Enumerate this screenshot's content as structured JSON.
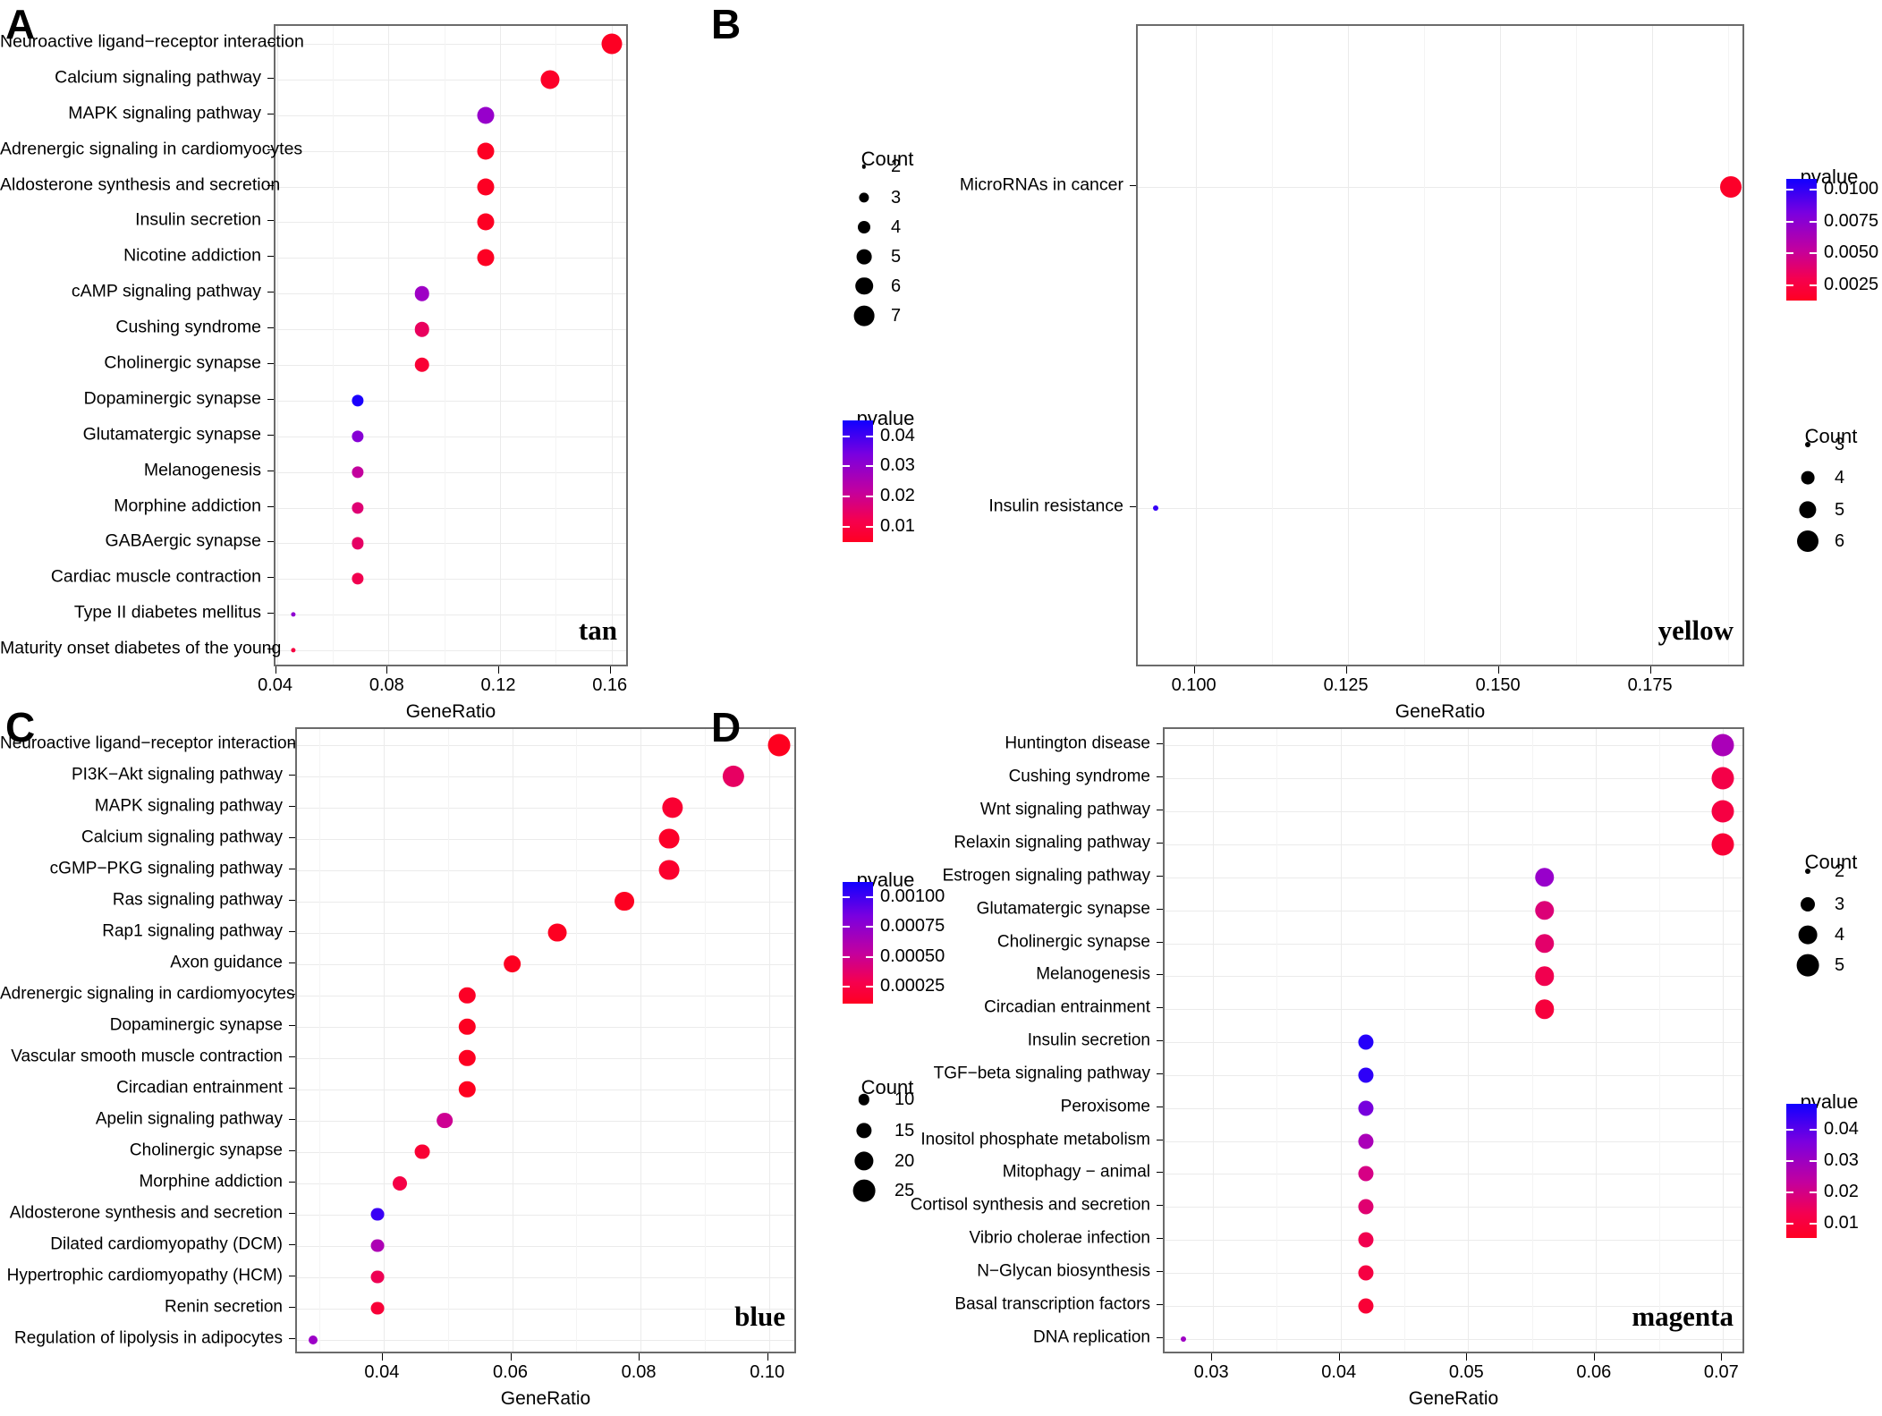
{
  "figure": {
    "axis_title": "GeneRatio",
    "legend_titles": {
      "count": "Count",
      "pvalue": "pvalue"
    }
  },
  "panels": [
    {
      "letter": "A",
      "module_tag": "tan",
      "chart_data": {
        "type": "scatter",
        "title": "",
        "xlabel": "GeneRatio",
        "ylabel": "",
        "xlim": [
          0.0395,
          0.1665
        ],
        "xticks": [
          "0.04",
          "0.08",
          "0.12",
          "0.16"
        ],
        "xtickvals": [
          0.04,
          0.08,
          0.12,
          0.16
        ],
        "grid": true,
        "legend_position": "right",
        "size_legend": {
          "title": "Count",
          "values": [
            2,
            3,
            4,
            5,
            6,
            7
          ]
        },
        "color_legend": {
          "title": "pvalue",
          "ticks": [
            "0.04",
            "0.03",
            "0.02",
            "0.01"
          ],
          "tickvals": [
            0.04,
            0.03,
            0.02,
            0.01
          ],
          "vmin": 0.0045,
          "vmax": 0.045
        },
        "categories": [
          "Neuroactive ligand-receptor interaction",
          "Calcium signaling pathway",
          "MAPK signaling pathway",
          "Adrenergic signaling in cardiomyocytes",
          "Aldosterone synthesis and secretion",
          "Insulin secretion",
          "Nicotine addiction",
          "cAMP signaling pathway",
          "Cushing syndrome",
          "Cholinergic synapse",
          "Dopaminergic synapse",
          "Glutamatergic synapse",
          "Melanogenesis",
          "Morphine addiction",
          "GABAergic synapse",
          "Cardiac muscle contraction",
          "Type II diabetes mellitus",
          "Maturity onset diabetes of the young"
        ],
        "points": [
          {
            "label": "Neuroactive ligand-receptor interaction",
            "x": 0.16,
            "count": 7,
            "pvalue": 0.006
          },
          {
            "label": "Calcium signaling pathway",
            "x": 0.138,
            "count": 6,
            "pvalue": 0.007
          },
          {
            "label": "MAPK signaling pathway",
            "x": 0.115,
            "count": 5,
            "pvalue": 0.031
          },
          {
            "label": "Adrenergic signaling in cardiomyocytes",
            "x": 0.115,
            "count": 5,
            "pvalue": 0.006
          },
          {
            "label": "Aldosterone synthesis and secretion",
            "x": 0.115,
            "count": 5,
            "pvalue": 0.006
          },
          {
            "label": "Insulin secretion",
            "x": 0.115,
            "count": 5,
            "pvalue": 0.006
          },
          {
            "label": "Nicotine addiction",
            "x": 0.115,
            "count": 5,
            "pvalue": 0.006
          },
          {
            "label": "cAMP signaling pathway",
            "x": 0.092,
            "count": 4,
            "pvalue": 0.03
          },
          {
            "label": "Cushing syndrome",
            "x": 0.092,
            "count": 4,
            "pvalue": 0.015
          },
          {
            "label": "Cholinergic synapse",
            "x": 0.092,
            "count": 4,
            "pvalue": 0.009
          },
          {
            "label": "Dopaminergic synapse",
            "x": 0.069,
            "count": 3,
            "pvalue": 0.044
          },
          {
            "label": "Glutamatergic synapse",
            "x": 0.069,
            "count": 3,
            "pvalue": 0.033
          },
          {
            "label": "Melanogenesis",
            "x": 0.069,
            "count": 3,
            "pvalue": 0.024
          },
          {
            "label": "Morphine addiction",
            "x": 0.069,
            "count": 3,
            "pvalue": 0.018
          },
          {
            "label": "GABAergic synapse",
            "x": 0.069,
            "count": 3,
            "pvalue": 0.016
          },
          {
            "label": "Cardiac muscle contraction",
            "x": 0.069,
            "count": 3,
            "pvalue": 0.013
          },
          {
            "label": "Type II diabetes mellitus",
            "x": 0.046,
            "count": 2,
            "pvalue": 0.032
          },
          {
            "label": "Maturity onset diabetes of the young",
            "x": 0.046,
            "count": 2,
            "pvalue": 0.011
          }
        ]
      }
    },
    {
      "letter": "B",
      "module_tag": "yellow",
      "chart_data": {
        "type": "scatter",
        "title": "",
        "xlabel": "GeneRatio",
        "ylabel": "",
        "xlim": [
          0.0905,
          0.1905
        ],
        "xticks": [
          "0.100",
          "0.125",
          "0.150",
          "0.175"
        ],
        "xtickvals": [
          0.1,
          0.125,
          0.15,
          0.175
        ],
        "grid": true,
        "legend_position": "right",
        "size_legend": {
          "title": "Count",
          "values": [
            3,
            4,
            5,
            6
          ]
        },
        "color_legend": {
          "title": "pvalue",
          "ticks": [
            "0.0100",
            "0.0075",
            "0.0050",
            "0.0025"
          ],
          "tickvals": [
            0.01,
            0.0075,
            0.005,
            0.0025
          ],
          "vmin": 0.0012,
          "vmax": 0.0108
        },
        "categories": [
          "MicroRNAs in cancer",
          "Insulin resistance"
        ],
        "points": [
          {
            "label": "MicroRNAs in cancer",
            "x": 0.188,
            "count": 6,
            "pvalue": 0.0018
          },
          {
            "label": "Insulin resistance",
            "x": 0.0935,
            "count": 3,
            "pvalue": 0.01
          }
        ]
      }
    },
    {
      "letter": "C",
      "module_tag": "blue",
      "chart_data": {
        "type": "scatter",
        "title": "",
        "xlabel": "GeneRatio",
        "ylabel": "",
        "xlim": [
          0.0265,
          0.1045
        ],
        "xticks": [
          "0.04",
          "0.06",
          "0.08",
          "0.10"
        ],
        "xtickvals": [
          0.04,
          0.06,
          0.08,
          0.1
        ],
        "grid": true,
        "legend_position": "right",
        "size_legend": {
          "title": "Count",
          "values": [
            10,
            15,
            20,
            25
          ]
        },
        "color_legend": {
          "title": "pvalue",
          "ticks": [
            "0.00100",
            "0.00075",
            "0.00050",
            "0.00025"
          ],
          "tickvals": [
            0.001,
            0.00075,
            0.0005,
            0.00025
          ],
          "vmin": 0.0001,
          "vmax": 0.00112
        },
        "categories": [
          "Neuroactive ligand-receptor interaction",
          "PI3K-Akt signaling pathway",
          "MAPK signaling pathway",
          "Calcium signaling pathway",
          "cGMP-PKG signaling pathway",
          "Ras signaling pathway",
          "Rap1 signaling pathway",
          "Axon guidance",
          "Adrenergic signaling in cardiomyocytes",
          "Dopaminergic synapse",
          "Vascular smooth muscle contraction",
          "Circadian entrainment",
          "Apelin signaling pathway",
          "Cholinergic synapse",
          "Morphine addiction",
          "Aldosterone synthesis and secretion",
          "Dilated cardiomyopathy (DCM)",
          "Hypertrophic cardiomyopathy (HCM)",
          "Renin secretion",
          "Regulation of lipolysis in adipocytes"
        ],
        "points": [
          {
            "label": "Neuroactive ligand-receptor interaction",
            "x": 0.1015,
            "count": 26,
            "pvalue": 0.00012
          },
          {
            "label": "PI3K-Akt signaling pathway",
            "x": 0.0945,
            "count": 24,
            "pvalue": 0.00038
          },
          {
            "label": "MAPK signaling pathway",
            "x": 0.085,
            "count": 22,
            "pvalue": 0.0002
          },
          {
            "label": "Calcium signaling pathway",
            "x": 0.0845,
            "count": 21,
            "pvalue": 0.00016
          },
          {
            "label": "cGMP-PKG signaling pathway",
            "x": 0.0845,
            "count": 21,
            "pvalue": 0.00018
          },
          {
            "label": "Ras signaling pathway",
            "x": 0.0775,
            "count": 19,
            "pvalue": 0.00013
          },
          {
            "label": "Rap1 signaling pathway",
            "x": 0.067,
            "count": 17,
            "pvalue": 0.00013
          },
          {
            "label": "Axon guidance",
            "x": 0.06,
            "count": 15,
            "pvalue": 0.00013
          },
          {
            "label": "Adrenergic signaling in cardiomyocytes",
            "x": 0.053,
            "count": 13,
            "pvalue": 0.00015
          },
          {
            "label": "Dopaminergic synapse",
            "x": 0.053,
            "count": 13,
            "pvalue": 0.00013
          },
          {
            "label": "Vascular smooth muscle contraction",
            "x": 0.053,
            "count": 13,
            "pvalue": 0.00013
          },
          {
            "label": "Circadian entrainment",
            "x": 0.053,
            "count": 13,
            "pvalue": 0.00012
          },
          {
            "label": "Apelin signaling pathway",
            "x": 0.0495,
            "count": 12,
            "pvalue": 0.00055
          },
          {
            "label": "Cholinergic synapse",
            "x": 0.046,
            "count": 11,
            "pvalue": 0.00021
          },
          {
            "label": "Morphine addiction",
            "x": 0.0425,
            "count": 10,
            "pvalue": 0.00028
          },
          {
            "label": "Aldosterone synthesis and secretion",
            "x": 0.039,
            "count": 9,
            "pvalue": 0.00102
          },
          {
            "label": "Dilated cardiomyopathy (DCM)",
            "x": 0.039,
            "count": 9,
            "pvalue": 0.00068
          },
          {
            "label": "Hypertrophic cardiomyopathy (HCM)",
            "x": 0.039,
            "count": 9,
            "pvalue": 0.00033
          },
          {
            "label": "Renin secretion",
            "x": 0.039,
            "count": 9,
            "pvalue": 0.00022
          },
          {
            "label": "Regulation of lipolysis in adipocytes",
            "x": 0.029,
            "count": 7,
            "pvalue": 0.00075
          }
        ]
      }
    },
    {
      "letter": "D",
      "module_tag": "magenta",
      "chart_data": {
        "type": "scatter",
        "title": "",
        "xlabel": "GeneRatio",
        "ylabel": "",
        "xlim": [
          0.0262,
          0.0718
        ],
        "xticks": [
          "0.03",
          "0.04",
          "0.05",
          "0.06",
          "0.07"
        ],
        "xtickvals": [
          0.03,
          0.04,
          0.05,
          0.06,
          0.07
        ],
        "grid": true,
        "legend_position": "right",
        "size_legend": {
          "title": "Count",
          "values": [
            2,
            3,
            4,
            5
          ]
        },
        "color_legend": {
          "title": "pvalue",
          "ticks": [
            "0.04",
            "0.03",
            "0.02",
            "0.01"
          ],
          "tickvals": [
            0.04,
            0.03,
            0.02,
            0.01
          ],
          "vmin": 0.005,
          "vmax": 0.048
        },
        "categories": [
          "Huntington disease",
          "Cushing syndrome",
          "Wnt signaling pathway",
          "Relaxin signaling pathway",
          "Estrogen signaling pathway",
          "Glutamatergic synapse",
          "Cholinergic synapse",
          "Melanogenesis",
          "Circadian entrainment",
          "Insulin secretion",
          "TGF-beta signaling pathway",
          "Peroxisome",
          "Inositol phosphate metabolism",
          "Mitophagy - animal",
          "Cortisol synthesis and secretion",
          "Vibrio cholerae infection",
          "N-Glycan biosynthesis",
          "Basal transcription factors",
          "DNA replication"
        ],
        "points": [
          {
            "label": "Huntington disease",
            "x": 0.07,
            "count": 5,
            "pvalue": 0.03
          },
          {
            "label": "Cushing syndrome",
            "x": 0.07,
            "count": 5,
            "pvalue": 0.013
          },
          {
            "label": "Wnt signaling pathway",
            "x": 0.07,
            "count": 5,
            "pvalue": 0.012
          },
          {
            "label": "Relaxin signaling pathway",
            "x": 0.07,
            "count": 5,
            "pvalue": 0.01
          },
          {
            "label": "Estrogen signaling pathway",
            "x": 0.056,
            "count": 4,
            "pvalue": 0.033
          },
          {
            "label": "Glutamatergic synapse",
            "x": 0.056,
            "count": 4,
            "pvalue": 0.02
          },
          {
            "label": "Cholinergic synapse",
            "x": 0.056,
            "count": 4,
            "pvalue": 0.018
          },
          {
            "label": "Melanogenesis",
            "x": 0.056,
            "count": 4,
            "pvalue": 0.014
          },
          {
            "label": "Circadian entrainment",
            "x": 0.056,
            "count": 4,
            "pvalue": 0.011
          },
          {
            "label": "Insulin secretion",
            "x": 0.042,
            "count": 3,
            "pvalue": 0.046
          },
          {
            "label": "TGF-beta signaling pathway",
            "x": 0.042,
            "count": 3,
            "pvalue": 0.045
          },
          {
            "label": "Peroxisome",
            "x": 0.042,
            "count": 3,
            "pvalue": 0.037
          },
          {
            "label": "Inositol phosphate metabolism",
            "x": 0.042,
            "count": 3,
            "pvalue": 0.03
          },
          {
            "label": "Mitophagy - animal",
            "x": 0.042,
            "count": 3,
            "pvalue": 0.022
          },
          {
            "label": "Cortisol synthesis and secretion",
            "x": 0.042,
            "count": 3,
            "pvalue": 0.019
          },
          {
            "label": "Vibrio cholerae infection",
            "x": 0.042,
            "count": 3,
            "pvalue": 0.014
          },
          {
            "label": "N-Glycan biosynthesis",
            "x": 0.042,
            "count": 3,
            "pvalue": 0.012
          },
          {
            "label": "Basal transcription factors",
            "x": 0.042,
            "count": 3,
            "pvalue": 0.01
          },
          {
            "label": "DNA replication",
            "x": 0.0277,
            "count": 2,
            "pvalue": 0.032
          }
        ]
      }
    }
  ]
}
